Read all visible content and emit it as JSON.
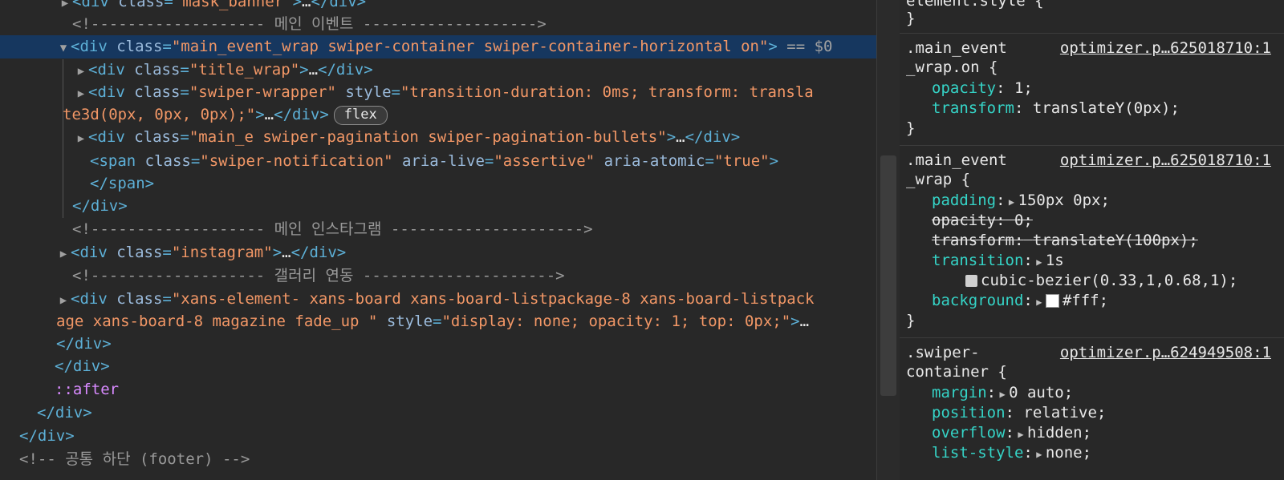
{
  "elements": {
    "lines": [
      {
        "name": "node-mask-banner",
        "parts": [
          [
            "tri",
            "▶"
          ],
          [
            "tag",
            "<div "
          ],
          [
            "attr",
            "class"
          ],
          [
            "tag",
            "="
          ],
          [
            "val",
            "\"mask_banner\""
          ],
          [
            "tag",
            ">"
          ],
          [
            "txt",
            "…"
          ],
          [
            "tag",
            "</div>"
          ]
        ]
      },
      {
        "name": "comment-main-event",
        "parts": [
          [
            "cmt",
            "<!------------------- 메인 이벤트 ------------------->"
          ]
        ]
      },
      {
        "name": "node-main-event-wrap",
        "parts": [
          [
            "tri",
            "▼"
          ],
          [
            "tag",
            "<div "
          ],
          [
            "attr",
            "class"
          ],
          [
            "tag",
            "="
          ],
          [
            "val",
            "\"main_event_wrap swiper-container swiper-container-horizontal on\""
          ],
          [
            "tag",
            ">"
          ],
          [
            "dim",
            " == $0"
          ]
        ]
      },
      {
        "name": "node-title-wrap",
        "parts": [
          [
            "tri",
            "▶"
          ],
          [
            "tag",
            "<div "
          ],
          [
            "attr",
            "class"
          ],
          [
            "tag",
            "="
          ],
          [
            "val",
            "\"title_wrap\""
          ],
          [
            "tag",
            ">"
          ],
          [
            "txt",
            "…"
          ],
          [
            "tag",
            "</div>"
          ]
        ]
      },
      {
        "name": "node-swiper-wrapper",
        "parts": [
          [
            "tri",
            "▶"
          ],
          [
            "tag",
            "<div "
          ],
          [
            "attr",
            "class"
          ],
          [
            "tag",
            "="
          ],
          [
            "val",
            "\"swiper-wrapper\""
          ],
          [
            "attr",
            " style"
          ],
          [
            "tag",
            "="
          ],
          [
            "val",
            "\"transition-duration: 0ms; transform: transla"
          ]
        ]
      },
      {
        "name": "node-swiper-wrapper-cont",
        "parts": [
          [
            "val",
            "te3d(0px, 0px, 0px);\""
          ],
          [
            "tag",
            ">"
          ],
          [
            "txt",
            "…"
          ],
          [
            "tag",
            "</div>"
          ]
        ],
        "badge": "flex"
      },
      {
        "name": "node-pagination",
        "parts": [
          [
            "tri",
            "▶"
          ],
          [
            "tag",
            "<div "
          ],
          [
            "attr",
            "class"
          ],
          [
            "tag",
            "="
          ],
          [
            "val",
            "\"main_e swiper-pagination swiper-pagination-bullets\""
          ],
          [
            "tag",
            ">"
          ],
          [
            "txt",
            "…"
          ],
          [
            "tag",
            "</div>"
          ]
        ]
      },
      {
        "name": "node-span-notification",
        "parts": [
          [
            "tag",
            "<span "
          ],
          [
            "attr",
            "class"
          ],
          [
            "tag",
            "="
          ],
          [
            "val",
            "\"swiper-notification\""
          ],
          [
            "attr",
            " aria-live"
          ],
          [
            "tag",
            "="
          ],
          [
            "val",
            "\"assertive\""
          ],
          [
            "attr",
            " aria-atomic"
          ],
          [
            "tag",
            "="
          ],
          [
            "val",
            "\"true\""
          ],
          [
            "tag",
            ">"
          ]
        ]
      },
      {
        "name": "node-span-close",
        "parts": [
          [
            "tag",
            "</span>"
          ]
        ]
      },
      {
        "name": "node-div-close-1",
        "parts": [
          [
            "tag",
            "</div>"
          ]
        ]
      },
      {
        "name": "comment-main-instagram",
        "parts": [
          [
            "cmt",
            "<!------------------- 메인 인스타그램 --------------------->"
          ]
        ]
      },
      {
        "name": "node-instagram",
        "parts": [
          [
            "tri",
            "▶"
          ],
          [
            "tag",
            "<div "
          ],
          [
            "attr",
            "class"
          ],
          [
            "tag",
            "="
          ],
          [
            "val",
            "\"instagram\""
          ],
          [
            "tag",
            ">"
          ],
          [
            "txt",
            "…"
          ],
          [
            "tag",
            "</div>"
          ]
        ]
      },
      {
        "name": "comment-gallery",
        "parts": [
          [
            "cmt",
            "<!------------------- 갤러리 연동 --------------------->"
          ]
        ]
      },
      {
        "name": "node-xans-element",
        "parts": [
          [
            "tri",
            "▶"
          ],
          [
            "tag",
            "<div "
          ],
          [
            "attr",
            "class"
          ],
          [
            "tag",
            "="
          ],
          [
            "val",
            "\"xans-element- xans-board xans-board-listpackage-8 xans-board-listpack"
          ]
        ]
      },
      {
        "name": "node-xans-element-cont",
        "parts": [
          [
            "val",
            "age xans-board-8 magazine fade_up \""
          ],
          [
            "attr",
            " style"
          ],
          [
            "tag",
            "="
          ],
          [
            "val",
            "\"display: none; opacity: 1; top: 0px;\""
          ],
          [
            "tag",
            ">"
          ],
          [
            "txt",
            "…"
          ]
        ]
      },
      {
        "name": "node-div-close-2",
        "parts": [
          [
            "tag",
            "</div>"
          ]
        ]
      },
      {
        "name": "node-div-close-3",
        "parts": [
          [
            "tag",
            "</div>"
          ]
        ]
      },
      {
        "name": "node-after",
        "parts": [
          [
            "pseudo",
            "::after"
          ]
        ]
      },
      {
        "name": "node-div-close-4",
        "parts": [
          [
            "tag",
            "</div>"
          ]
        ]
      },
      {
        "name": "node-div-close-5",
        "parts": [
          [
            "tag",
            "</div>"
          ]
        ]
      },
      {
        "name": "comment-footer",
        "parts": [
          [
            "cmt",
            "<!-- 공통 하단 (footer) -->"
          ]
        ]
      }
    ]
  },
  "styles": {
    "element_style_selector": "element.style {",
    "element_style_close": "}",
    "rules": [
      {
        "sel1": ".main_event",
        "sel2": "_wrap.on {",
        "source": "optimizer.p…625018710:1",
        "props": [
          {
            "p": "opacity",
            "v": "1;"
          },
          {
            "p": "transform",
            "v": "translateY(0px);"
          }
        ]
      },
      {
        "sel1": ".main_event",
        "sel2": "_wrap {",
        "source": "optimizer.p…625018710:1",
        "props": [
          {
            "p": "padding",
            "v": "150px 0px;",
            "tri": true
          },
          {
            "p": "opacity",
            "v": "0;",
            "strike": true
          },
          {
            "p": "transform",
            "v": "translateY(100px);",
            "strike": true
          },
          {
            "p": "transition",
            "v": "1s",
            "tri": true
          },
          {
            "p": "",
            "v": "cubic-bezier(0.33,1,0.68,1);",
            "curve": true
          },
          {
            "p": "background",
            "v": "#fff;",
            "tri": true,
            "swatch": "#ffffff"
          }
        ]
      },
      {
        "sel1": ".swiper-",
        "sel2": "container {",
        "source": "optimizer.p…624949508:1",
        "props": [
          {
            "p": "margin",
            "v": "0 auto;",
            "tri": true
          },
          {
            "p": "position",
            "v": "relative;"
          },
          {
            "p": "overflow",
            "v": "hidden;",
            "tri": true
          },
          {
            "p": "list-style",
            "v": "none;",
            "tri": true
          }
        ]
      }
    ]
  }
}
